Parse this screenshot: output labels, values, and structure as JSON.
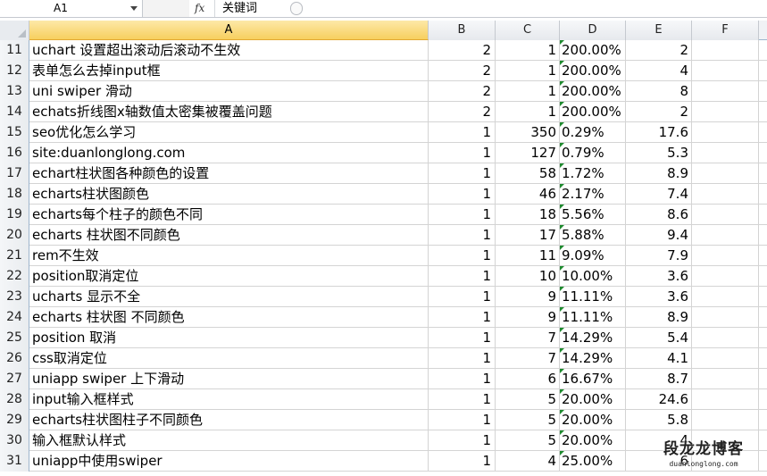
{
  "formula_bar": {
    "name_box": "A1",
    "fx_label": "fx",
    "content": "关键词"
  },
  "columns": [
    "A",
    "B",
    "C",
    "D",
    "E",
    "F"
  ],
  "selected_column": "A",
  "rows": [
    {
      "num": "11",
      "a": "uchart 设置超出滚动后滚动不生效",
      "b": "2",
      "c": "1",
      "d": "200.00%",
      "e": "2"
    },
    {
      "num": "12",
      "a": "表单怎么去掉input框",
      "b": "2",
      "c": "1",
      "d": "200.00%",
      "e": "4"
    },
    {
      "num": "13",
      "a": "uni swiper 滑动",
      "b": "2",
      "c": "1",
      "d": "200.00%",
      "e": "8"
    },
    {
      "num": "14",
      "a": "echats折线图x轴数值太密集被覆盖问题",
      "b": "2",
      "c": "1",
      "d": "200.00%",
      "e": "2"
    },
    {
      "num": "15",
      "a": "seo优化怎么学习",
      "b": "1",
      "c": "350",
      "d": "0.29%",
      "e": "17.6"
    },
    {
      "num": "16",
      "a": "site:duanlonglong.com",
      "b": "1",
      "c": "127",
      "d": "0.79%",
      "e": "5.3"
    },
    {
      "num": "17",
      "a": "echart柱状图各种颜色的设置",
      "b": "1",
      "c": "58",
      "d": "1.72%",
      "e": "8.9"
    },
    {
      "num": "18",
      "a": "echarts柱状图颜色",
      "b": "1",
      "c": "46",
      "d": "2.17%",
      "e": "7.4"
    },
    {
      "num": "19",
      "a": "echarts每个柱子的颜色不同",
      "b": "1",
      "c": "18",
      "d": "5.56%",
      "e": "8.6"
    },
    {
      "num": "20",
      "a": "echarts 柱状图不同颜色",
      "b": "1",
      "c": "17",
      "d": "5.88%",
      "e": "9.4"
    },
    {
      "num": "21",
      "a": "rem不生效",
      "b": "1",
      "c": "11",
      "d": "9.09%",
      "e": "7.9"
    },
    {
      "num": "22",
      "a": "position取消定位",
      "b": "1",
      "c": "10",
      "d": "10.00%",
      "e": "3.6"
    },
    {
      "num": "23",
      "a": "ucharts 显示不全",
      "b": "1",
      "c": "9",
      "d": "11.11%",
      "e": "3.6"
    },
    {
      "num": "24",
      "a": "echarts 柱状图 不同颜色",
      "b": "1",
      "c": "9",
      "d": "11.11%",
      "e": "8.9"
    },
    {
      "num": "25",
      "a": "position 取消",
      "b": "1",
      "c": "7",
      "d": "14.29%",
      "e": "5.4"
    },
    {
      "num": "26",
      "a": "css取消定位",
      "b": "1",
      "c": "7",
      "d": "14.29%",
      "e": "4.1"
    },
    {
      "num": "27",
      "a": "uniapp swiper 上下滑动",
      "b": "1",
      "c": "6",
      "d": "16.67%",
      "e": "8.7"
    },
    {
      "num": "28",
      "a": "input输入框样式",
      "b": "1",
      "c": "5",
      "d": "20.00%",
      "e": "24.6"
    },
    {
      "num": "29",
      "a": "echarts柱状图柱子不同颜色",
      "b": "1",
      "c": "5",
      "d": "20.00%",
      "e": "5.8"
    },
    {
      "num": "30",
      "a": "输入框默认样式",
      "b": "1",
      "c": "5",
      "d": "20.00%",
      "e": "4"
    },
    {
      "num": "31",
      "a": "uniapp中使用swiper",
      "b": "1",
      "c": "4",
      "d": "25.00%",
      "e": "6"
    }
  ],
  "watermark": {
    "title": "段龙龙博客",
    "url": "duanlonglong.com"
  },
  "colors": {
    "header_bg": "#f0f2f5",
    "selected_header": "#f7cf5e",
    "grid_line": "#d4d4d4",
    "error_triangle": "#1e8a2e"
  }
}
